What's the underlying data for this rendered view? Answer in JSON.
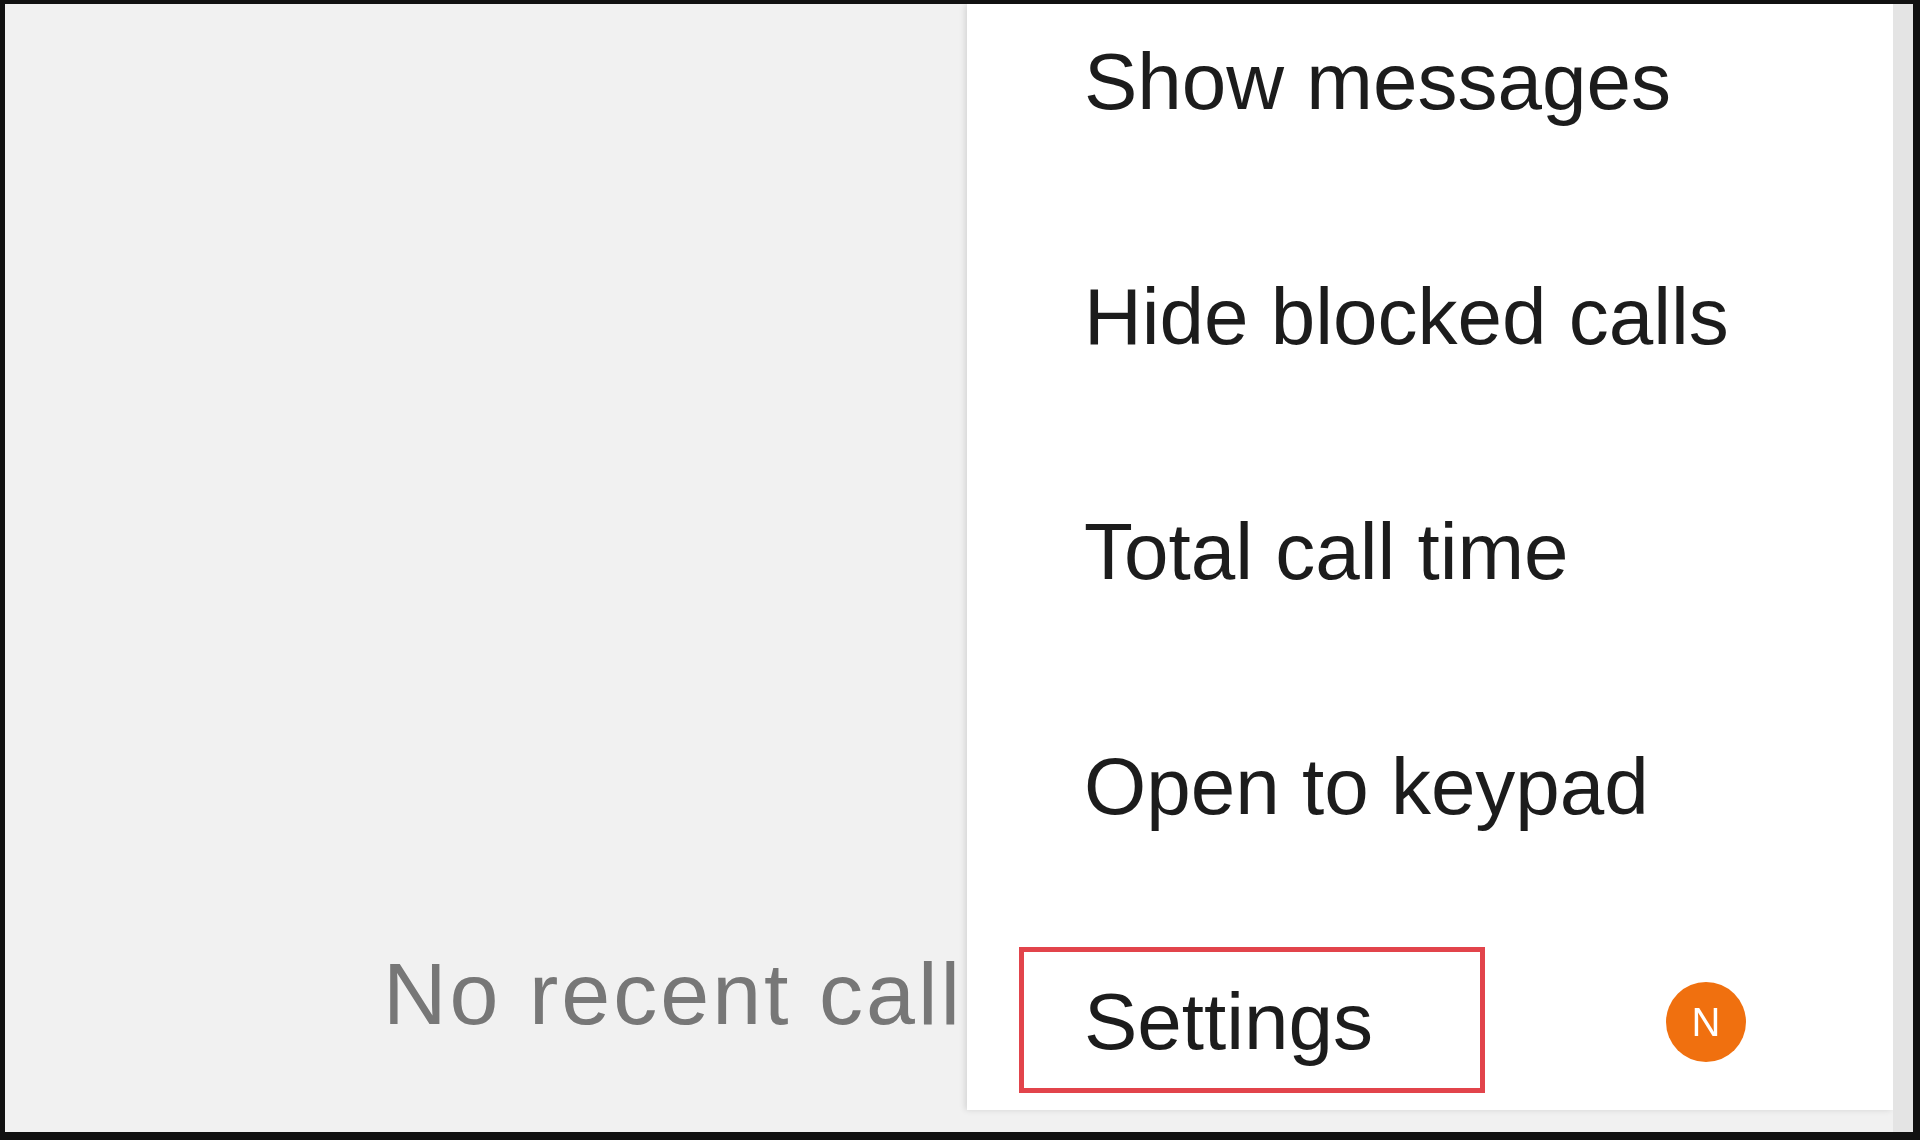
{
  "empty_state": {
    "message": "No recent call"
  },
  "menu": {
    "items": [
      {
        "label": "Show messages",
        "highlighted": false
      },
      {
        "label": "Hide blocked calls",
        "highlighted": false
      },
      {
        "label": "Total call time",
        "highlighted": false
      },
      {
        "label": "Open to keypad",
        "highlighted": false
      },
      {
        "label": "Settings",
        "highlighted": true,
        "badge": "N"
      }
    ]
  }
}
